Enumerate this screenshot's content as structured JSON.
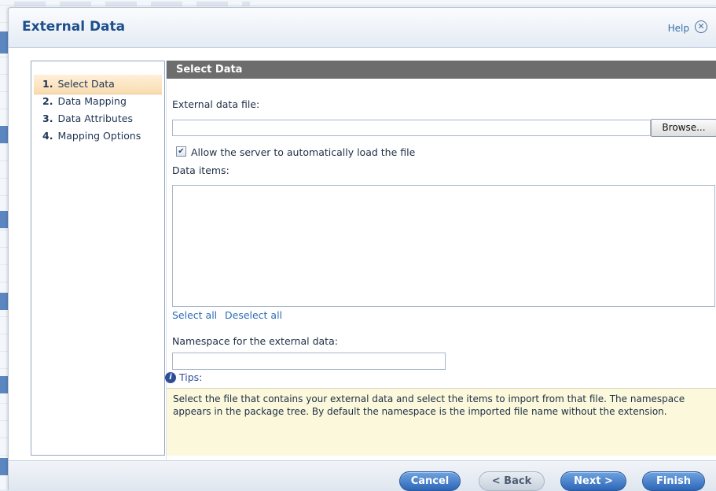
{
  "dialog": {
    "title": "External Data",
    "help_label": "Help",
    "close_glyph": "✕"
  },
  "steps": [
    {
      "num": "1.",
      "label": "Select Data",
      "active": true
    },
    {
      "num": "2.",
      "label": "Data Mapping",
      "active": false
    },
    {
      "num": "3.",
      "label": "Data Attributes",
      "active": false
    },
    {
      "num": "4.",
      "label": "Mapping Options",
      "active": false
    }
  ],
  "panel": {
    "header": "Select Data",
    "file_label": "External data file:",
    "file_value": "",
    "browse_label": "Browse...",
    "auto_load_label": "Allow the server to automatically load the file",
    "auto_load_checked": true,
    "items_label": "Data items:",
    "items": [],
    "select_all": "Select all",
    "deselect_all": "Deselect all",
    "namespace_label": "Namespace for the external data:",
    "namespace_value": "",
    "tips_label": "Tips:",
    "tips_text": "Select the file that contains your external data and select the items to import from that file. The namespace appears in the package tree. By default the namespace is the imported file name without the extension."
  },
  "footer": {
    "cancel": "Cancel",
    "back": "< Back",
    "next": "Next >",
    "finish": "Finish"
  },
  "colors": {
    "title": "#1c4f8c",
    "header_bg": "#6d6d6d",
    "active_step": "#f8dcb0",
    "tips_bg": "#fbf8dc",
    "button_blue": "#2d66b7"
  },
  "icons": {
    "close": "close-circle-icon",
    "info": "info-icon",
    "check": "checkmark-icon"
  }
}
